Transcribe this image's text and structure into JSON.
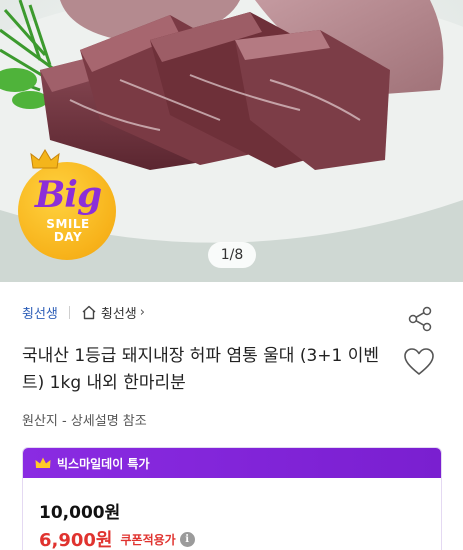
{
  "gallery": {
    "counter": "1/8"
  },
  "promo_badge": {
    "big": "Big",
    "line1": "SMILE",
    "line2": "DAY",
    "icon": "crown-icon"
  },
  "breadcrumb": {
    "brand": "췽선생",
    "store": "췽선생",
    "chevron": "›"
  },
  "product": {
    "title": "국내산 1등급 돼지내장 허파 염통 울대 (3+1 이벤트) 1kg 내외 한마리분",
    "origin": "원산지 - 상세설명 참조"
  },
  "deal": {
    "label": "빅스마일데이 특가",
    "original_price": "10,000원",
    "sale_price": "6,900원",
    "coupon_note": "쿠폰적용가",
    "info": "i"
  },
  "icons": {
    "share": "share-icon",
    "wishlist": "heart-icon",
    "home": "home-icon"
  },
  "colors": {
    "brand_link": "#2e5fb8",
    "deal_purple": "#8a2be2",
    "sale_red": "#e0332f",
    "badge_yellow": "#f7b21a"
  }
}
